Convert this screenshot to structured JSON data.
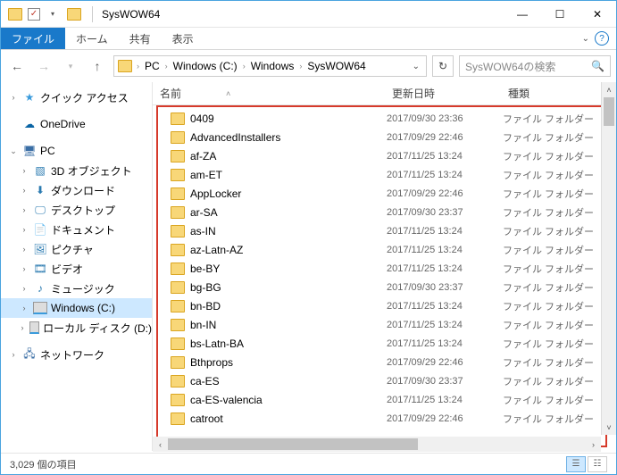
{
  "window": {
    "title": "SysWOW64"
  },
  "tabs": {
    "file": "ファイル",
    "home": "ホーム",
    "share": "共有",
    "view": "表示"
  },
  "breadcrumb": [
    "PC",
    "Windows (C:)",
    "Windows",
    "SysWOW64"
  ],
  "search": {
    "placeholder": "SysWOW64の検索"
  },
  "tree": {
    "quick": "クイック アクセス",
    "onedrive": "OneDrive",
    "pc": "PC",
    "pc_children": {
      "obj3d": "3D オブジェクト",
      "downloads": "ダウンロード",
      "desktop": "デスクトップ",
      "documents": "ドキュメント",
      "pictures": "ピクチャ",
      "videos": "ビデオ",
      "music": "ミュージック",
      "drive_c": "Windows (C:)",
      "drive_d": "ローカル ディスク (D:)"
    },
    "network": "ネットワーク"
  },
  "columns": {
    "name": "名前",
    "date": "更新日時",
    "type": "種類"
  },
  "type_folder": "ファイル フォルダー",
  "files": [
    {
      "name": "0409",
      "date": "2017/09/30 23:36"
    },
    {
      "name": "AdvancedInstallers",
      "date": "2017/09/29 22:46"
    },
    {
      "name": "af-ZA",
      "date": "2017/11/25 13:24"
    },
    {
      "name": "am-ET",
      "date": "2017/11/25 13:24"
    },
    {
      "name": "AppLocker",
      "date": "2017/09/29 22:46"
    },
    {
      "name": "ar-SA",
      "date": "2017/09/30 23:37"
    },
    {
      "name": "as-IN",
      "date": "2017/11/25 13:24"
    },
    {
      "name": "az-Latn-AZ",
      "date": "2017/11/25 13:24"
    },
    {
      "name": "be-BY",
      "date": "2017/11/25 13:24"
    },
    {
      "name": "bg-BG",
      "date": "2017/09/30 23:37"
    },
    {
      "name": "bn-BD",
      "date": "2017/11/25 13:24"
    },
    {
      "name": "bn-IN",
      "date": "2017/11/25 13:24"
    },
    {
      "name": "bs-Latn-BA",
      "date": "2017/11/25 13:24"
    },
    {
      "name": "Bthprops",
      "date": "2017/09/29 22:46"
    },
    {
      "name": "ca-ES",
      "date": "2017/09/30 23:37"
    },
    {
      "name": "ca-ES-valencia",
      "date": "2017/11/25 13:24"
    },
    {
      "name": "catroot",
      "date": "2017/09/29 22:46"
    }
  ],
  "status": {
    "items": "3,029 個の項目"
  }
}
